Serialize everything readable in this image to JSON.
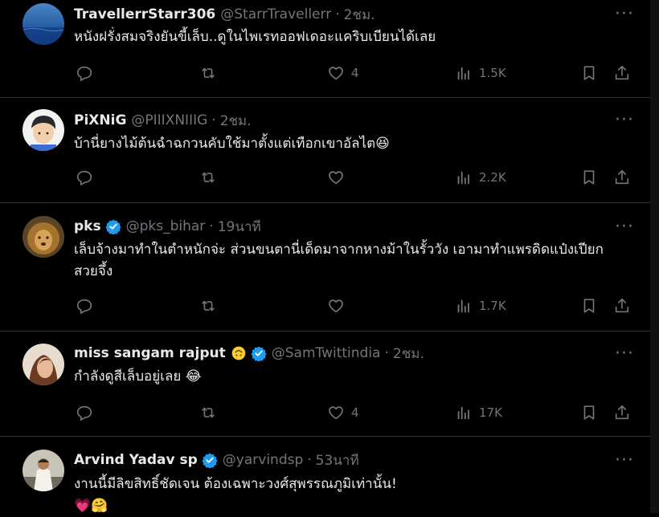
{
  "tweets": [
    {
      "name": "TravellerrStarr306",
      "handle": "@StarrTravellerr",
      "separator": "·",
      "time": "2ชม.",
      "text": "หนังฝรั่งสมจริงยันขี้เล็บ..ดูในไพเรทออฟเดอะแคริบเบียนได้เลย",
      "reply_count": "",
      "retweet_count": "",
      "like_count": "4",
      "view_count": "1.5K"
    },
    {
      "name": "PiXNiG",
      "handle": "@PIIIXNIIIG",
      "separator": "·",
      "time": "2ชม.",
      "text": "บ้านี่ยางไม้ต้นฉำฉกวนคับใช้มาตั้งแต่เทือกเขาอัลไต😆",
      "reply_count": "",
      "retweet_count": "",
      "like_count": "",
      "view_count": "2.2K"
    },
    {
      "name": "pks",
      "handle": "@pks_bihar",
      "separator": "·",
      "time": "19นาที",
      "text": "เล็บจ้างมาทำในตำหนักจ่ะ ส่วนขนตานี่เด็ดมาจากหางม้าในรั้ววัง เอามาทำแพรดิดแป๋งเปียก สวยจึ้ง",
      "reply_count": "",
      "retweet_count": "",
      "like_count": "",
      "view_count": "1.7K"
    },
    {
      "name": "miss sangam rajput",
      "handle": "@SamTwittindia",
      "separator": "·",
      "time": "2ชม.",
      "text": "กำลังดูสีเล็บอยู่เลย 😂",
      "reply_count": "",
      "retweet_count": "",
      "like_count": "4",
      "view_count": "17K"
    },
    {
      "name": "Arvind Yadav sp",
      "handle": "@yarvindsp",
      "separator": "·",
      "time": "53นาที",
      "text": "งานนี้มีลิขสิทธิ์ชัดเจน ต้องเฉพาะวงศ์สุพรรณภูมิเท่านั้น!",
      "text2": "💗🤗",
      "reply_count": "",
      "retweet_count": "",
      "like_count": "",
      "view_count": ""
    }
  ],
  "colors": {
    "background": "#000000",
    "text": "#e7e9ea",
    "muted": "#71767b",
    "border": "#2f3336",
    "verified": "#1d9bf0"
  },
  "icons": [
    "reply-icon",
    "retweet-icon",
    "like-icon",
    "views-icon",
    "bookmark-icon",
    "share-icon",
    "more-icon",
    "verified-badge-icon"
  ]
}
